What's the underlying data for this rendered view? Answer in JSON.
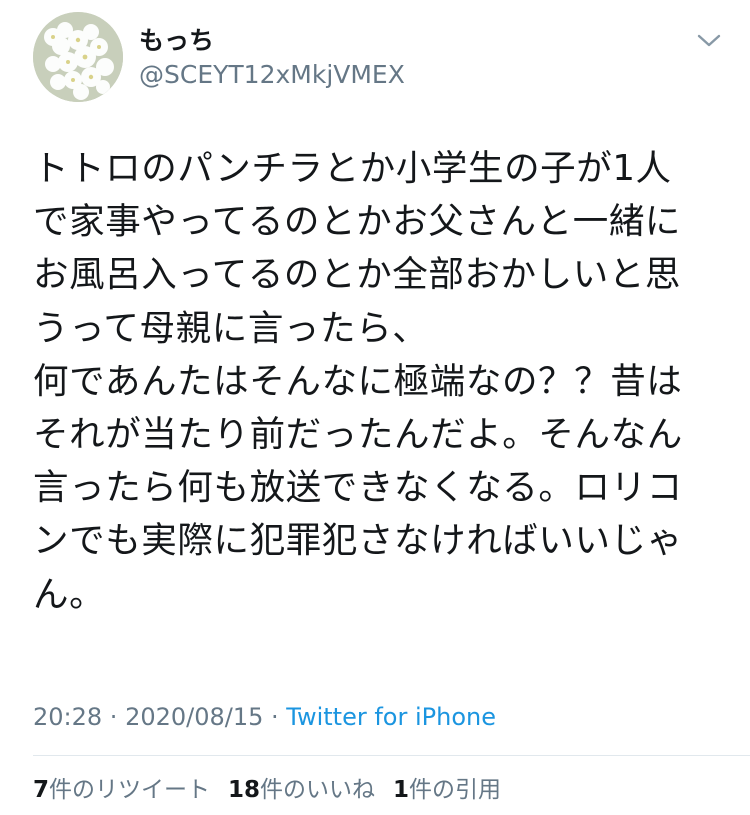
{
  "tweet": {
    "author": {
      "display_name": "もっち",
      "handle": "@SCEYT12xMkjVMEX"
    },
    "menu_icon": "chevron-down-icon",
    "avatar_icon": "white-flowers-avatar",
    "text_lines": [
      "トトロのパンチラとか小学生の子が1人",
      "で家事やってるのとかお父さんと一緒に",
      "お風呂入ってるのとか全部おかしいと思",
      "うって母親に言ったら、",
      "何であんたはそんなに極端なの？？昔は",
      "それが当たり前だったんだよ。そんなん",
      "言ったら何も放送できなくなる。ロリコ",
      "ンでも実際に犯罪犯さなければいいじゃ",
      "ん。"
    ],
    "time": "20:28",
    "separator1": " · ",
    "date": "2020/08/15",
    "separator2": " · ",
    "source": "Twitter for iPhone",
    "stats": {
      "retweets_count": "7",
      "retweets_label": "件のリツイート",
      "likes_count": "18",
      "likes_label": "件のいいね",
      "quotes_count": "1",
      "quotes_label": "件の引用"
    }
  },
  "colors": {
    "text": "#14171a",
    "secondary": "#657786",
    "link": "#1b95e0",
    "divider": "#e1e8ed"
  }
}
